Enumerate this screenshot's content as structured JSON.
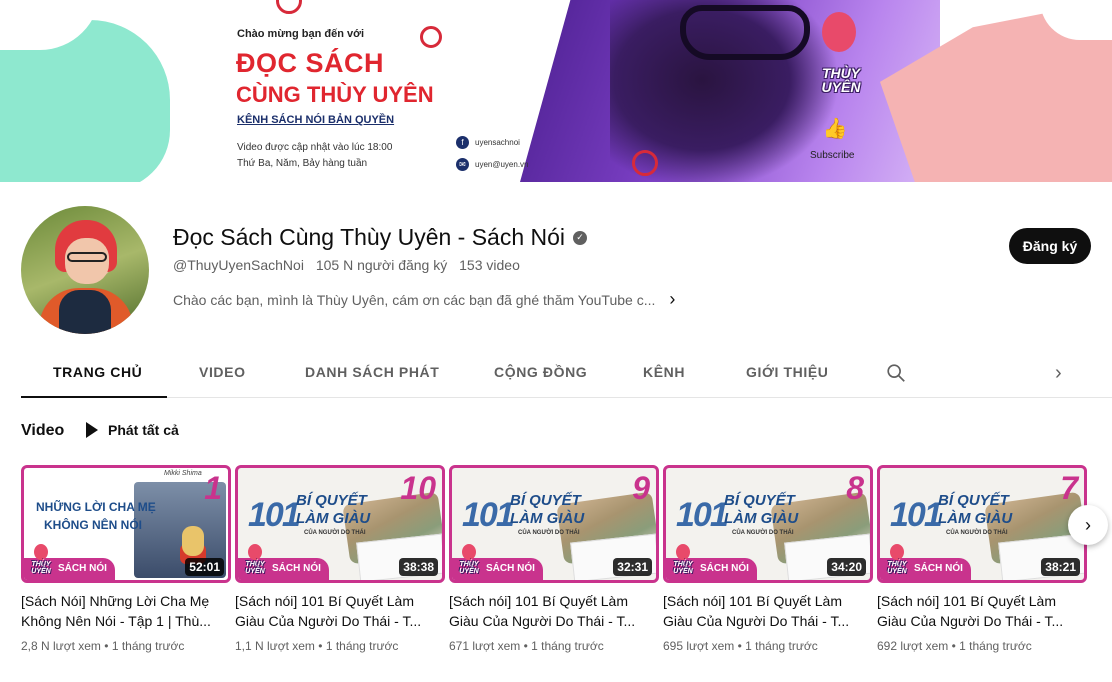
{
  "banner": {
    "welcome": "Chào mừng bạn đến với",
    "title_line1": "ĐỌC SÁCH",
    "title_line2": "CÙNG THÙY UYÊN",
    "tagline": "KÊNH SÁCH NÓI BẢN QUYỀN",
    "update_line1": "Video được cập nhật vào lúc 18:00",
    "update_line2": "Thứ Ba, Năm, Bảy hàng tuần",
    "facebook": "uyensachnoi",
    "email": "uyen@uyen.vn",
    "logo_text": "THÙY UYÊN",
    "subscribe_text": "Subscribe",
    "accent_color": "#e0262f"
  },
  "channel": {
    "name": "Đọc Sách Cùng Thùy Uyên - Sách Nói",
    "handle": "@ThuyUyenSachNoi",
    "subscribers": "105 N người đăng ký",
    "video_count": "153 video",
    "description": "Chào các bạn, mình là Thùy Uyên, cám ơn các bạn đã ghé thăm YouTube c...",
    "subscribe_label": "Đăng ký",
    "verified_icon": "check-circle-icon"
  },
  "tabs": [
    {
      "label": "TRANG CHỦ",
      "active": true
    },
    {
      "label": "VIDEO"
    },
    {
      "label": "DANH SÁCH PHÁT"
    },
    {
      "label": "CỘNG ĐỒNG"
    },
    {
      "label": "KÊNH"
    },
    {
      "label": "GIỚI THIỆU"
    }
  ],
  "section": {
    "title": "Video",
    "play_all": "Phát tất cả"
  },
  "videos": [
    {
      "title": "[Sách Nói] Những Lời Cha Mẹ Không Nên Nói - Tập 1 | Thù...",
      "views": "2,8 N lượt xem",
      "age": "1 tháng trước",
      "duration": "52:01",
      "episode": "1",
      "thumb_line1": "NHỮNG LỜI CHA MẸ",
      "thumb_line2": "KHÔNG NÊN NÓI",
      "thumb_author": "Mikki Shima",
      "badge": "SÁCH NÓI"
    },
    {
      "title": "[Sách nói] 101 Bí Quyết Làm Giàu Của Người Do Thái - T...",
      "views": "1,1 N lượt xem",
      "age": "1 tháng trước",
      "duration": "38:38",
      "episode": "10",
      "thumb_number": "101",
      "thumb_line1": "BÍ QUYẾT",
      "thumb_line2": "LÀM GIÀU",
      "thumb_sub": "CỦA NGƯỜI DO THÁI",
      "badge": "SÁCH NÓI"
    },
    {
      "title": "[Sách nói] 101 Bí Quyết Làm Giàu Của Người Do Thái - T...",
      "views": "671 lượt xem",
      "age": "1 tháng trước",
      "duration": "32:31",
      "episode": "9",
      "thumb_number": "101",
      "thumb_line1": "BÍ QUYẾT",
      "thumb_line2": "LÀM GIÀU",
      "thumb_sub": "CỦA NGƯỜI DO THÁI",
      "badge": "SÁCH NÓI"
    },
    {
      "title": "[Sách nói] 101 Bí Quyết Làm Giàu Của Người Do Thái - T...",
      "views": "695 lượt xem",
      "age": "1 tháng trước",
      "duration": "34:20",
      "episode": "8",
      "thumb_number": "101",
      "thumb_line1": "BÍ QUYẾT",
      "thumb_line2": "LÀM GIÀU",
      "thumb_sub": "CỦA NGƯỜI DO THÁI",
      "badge": "SÁCH NÓI"
    },
    {
      "title": "[Sách nói] 101 Bí Quyết Làm Giàu Của Người Do Thái - T...",
      "views": "692 lượt xem",
      "age": "1 tháng trước",
      "duration": "38:21",
      "episode": "7",
      "thumb_number": "101",
      "thumb_line1": "BÍ QUYẾT",
      "thumb_line2": "LÀM GIÀU",
      "thumb_sub": "CỦA NGƯỜI DO THÁI",
      "badge": "SÁCH NÓI"
    }
  ],
  "separator": "•",
  "thumb_logo_text": "THÙY UYÊN",
  "icons": {
    "search": "search-icon",
    "tabs_next": "chevron-right-icon",
    "carousel_next": "chevron-right-icon",
    "play_all": "play-icon"
  }
}
